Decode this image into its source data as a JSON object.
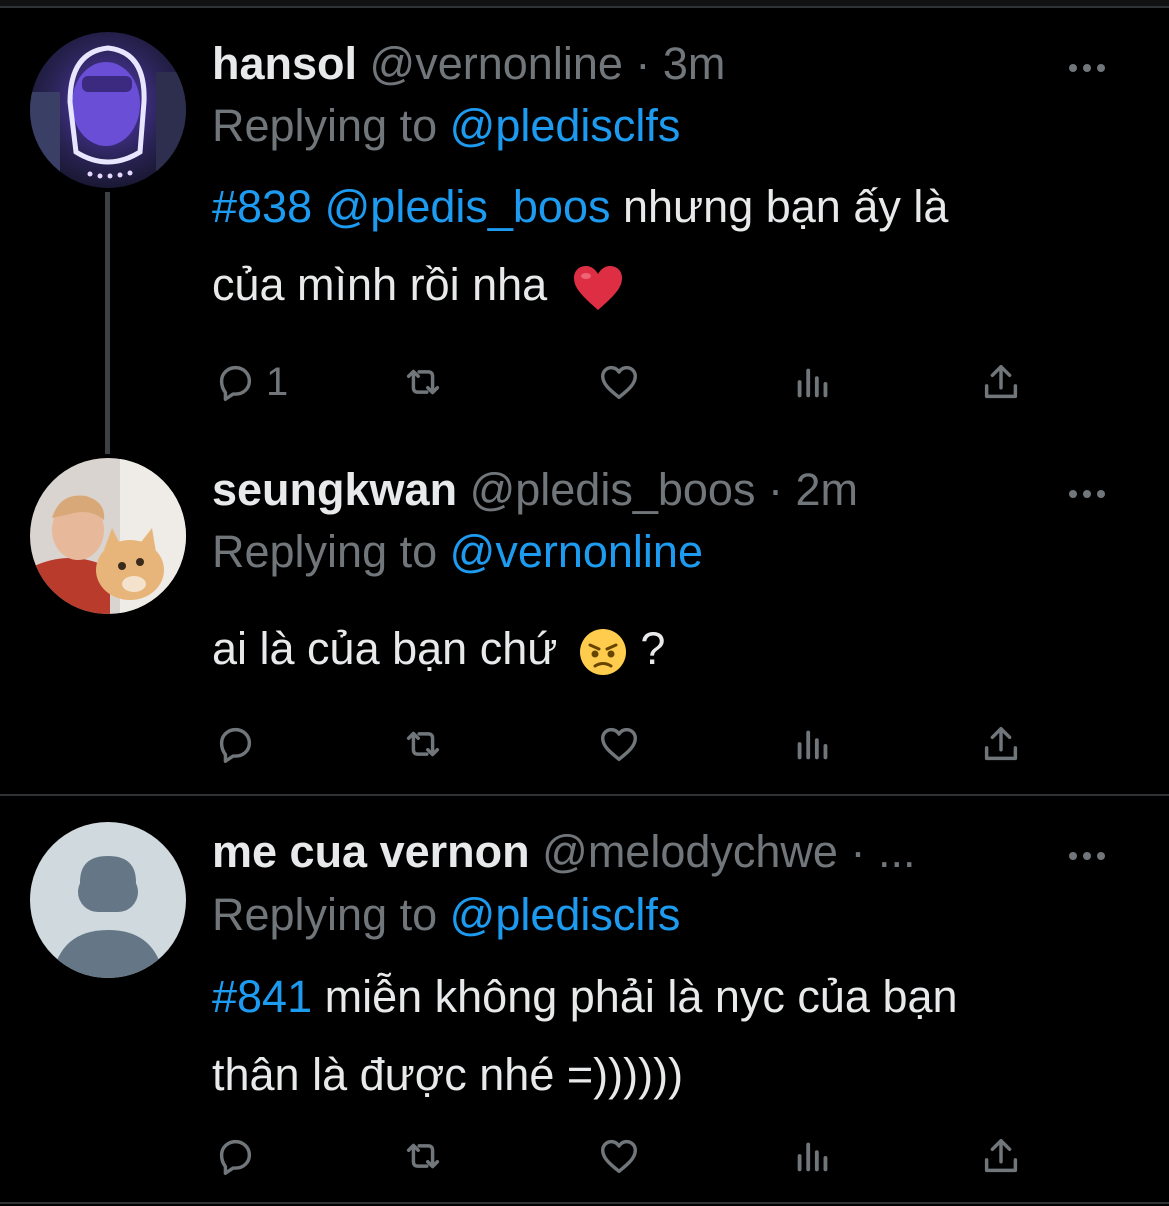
{
  "tweets": [
    {
      "name": "hansol",
      "handle": "@vernonline",
      "time": "· 3m",
      "replying_prefix": "Replying to",
      "replying_to": "@pledisclfs",
      "hashtag": "#838",
      "mention": "@pledis_boos",
      "text1": " nhưng bạn ấy là",
      "text2": "của mình rồi nha",
      "reply_count": "1",
      "more_icon": "more-icon"
    },
    {
      "name": "seungkwan",
      "handle": "@pledis_boos",
      "time": "· 2m",
      "replying_prefix": "Replying to",
      "replying_to": "@vernonline",
      "text1": "ai là của bạn chứ",
      "text_suffix": " ?",
      "reply_count": ""
    },
    {
      "name": "me cua vernon",
      "handle": "@melodychwe",
      "time": "· ...",
      "replying_prefix": "Replying to",
      "replying_to": "@pledisclfs",
      "hashtag": "#841",
      "text1": " miễn không phải là nyc của bạn",
      "text2": "thân là được nhé =))))))",
      "reply_count": ""
    }
  ],
  "colors": {
    "link": "#1d9bf0",
    "muted": "#71767b",
    "background": "#000000"
  },
  "icons": [
    "reply-icon",
    "retweet-icon",
    "like-icon",
    "views-icon",
    "share-icon",
    "heart-emoji",
    "angry-emoji"
  ]
}
